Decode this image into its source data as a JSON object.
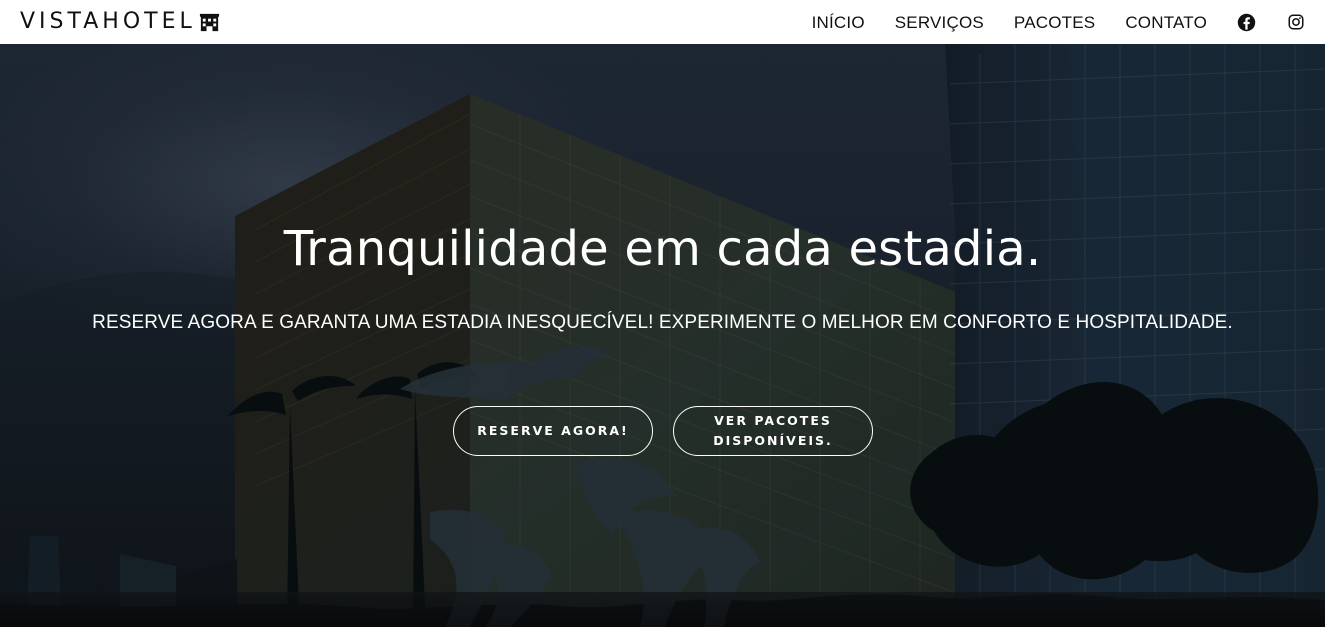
{
  "header": {
    "brand": "VISTAHOTEL",
    "brand_icon": "hotel-building-icon",
    "nav_items": [
      {
        "label": "INÍCIO"
      },
      {
        "label": "SERVIÇOS"
      },
      {
        "label": "PACOTES"
      },
      {
        "label": "CONTATO"
      }
    ],
    "social_icons": [
      "facebook-icon",
      "instagram-icon"
    ]
  },
  "hero": {
    "title": "Tranquilidade em cada estadia.",
    "subtitle": "RESERVE AGORA E GARANTA UMA ESTADIA INESQUECÍVEL! EXPERIMENTE O MELHOR EM CONFORTO E HOSPITALIDADE.",
    "buttons": [
      {
        "label": "RESERVE AGORA!"
      },
      {
        "label": "VER PACOTES DISPONÍVEIS."
      }
    ]
  },
  "colors": {
    "header_background": "#ffffff",
    "text_dark": "#111111",
    "hero_text": "#ffffff",
    "button_border": "#ffffff"
  }
}
